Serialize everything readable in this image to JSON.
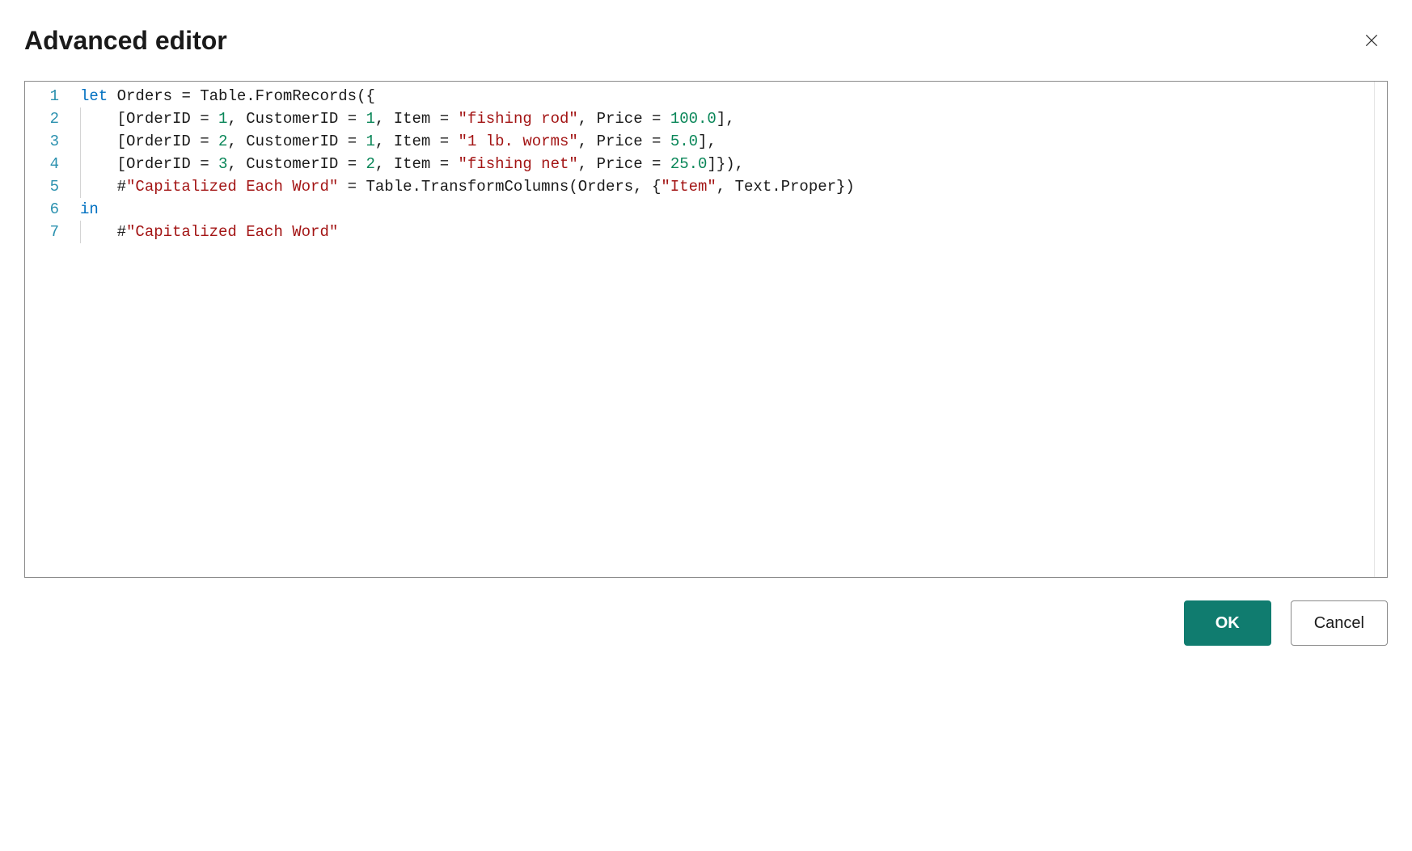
{
  "header": {
    "title": "Advanced editor"
  },
  "editor": {
    "lines": [
      {
        "num": "1",
        "indent": false,
        "tokens": [
          {
            "cls": "kw",
            "t": "let"
          },
          {
            "cls": "ident",
            "t": " Orders "
          },
          {
            "cls": "punct",
            "t": "="
          },
          {
            "cls": "ident",
            "t": " Table.FromRecords"
          },
          {
            "cls": "punct",
            "t": "({"
          }
        ]
      },
      {
        "num": "2",
        "indent": true,
        "tokens": [
          {
            "cls": "punct",
            "t": "    ["
          },
          {
            "cls": "ident",
            "t": "OrderID "
          },
          {
            "cls": "punct",
            "t": "= "
          },
          {
            "cls": "num",
            "t": "1"
          },
          {
            "cls": "punct",
            "t": ", "
          },
          {
            "cls": "ident",
            "t": "CustomerID "
          },
          {
            "cls": "punct",
            "t": "= "
          },
          {
            "cls": "num",
            "t": "1"
          },
          {
            "cls": "punct",
            "t": ", "
          },
          {
            "cls": "ident",
            "t": "Item "
          },
          {
            "cls": "punct",
            "t": "= "
          },
          {
            "cls": "str",
            "t": "\"fishing rod\""
          },
          {
            "cls": "punct",
            "t": ", "
          },
          {
            "cls": "ident",
            "t": "Price "
          },
          {
            "cls": "punct",
            "t": "= "
          },
          {
            "cls": "num",
            "t": "100.0"
          },
          {
            "cls": "punct",
            "t": "],"
          }
        ]
      },
      {
        "num": "3",
        "indent": true,
        "tokens": [
          {
            "cls": "punct",
            "t": "    ["
          },
          {
            "cls": "ident",
            "t": "OrderID "
          },
          {
            "cls": "punct",
            "t": "= "
          },
          {
            "cls": "num",
            "t": "2"
          },
          {
            "cls": "punct",
            "t": ", "
          },
          {
            "cls": "ident",
            "t": "CustomerID "
          },
          {
            "cls": "punct",
            "t": "= "
          },
          {
            "cls": "num",
            "t": "1"
          },
          {
            "cls": "punct",
            "t": ", "
          },
          {
            "cls": "ident",
            "t": "Item "
          },
          {
            "cls": "punct",
            "t": "= "
          },
          {
            "cls": "str",
            "t": "\"1 lb. worms\""
          },
          {
            "cls": "punct",
            "t": ", "
          },
          {
            "cls": "ident",
            "t": "Price "
          },
          {
            "cls": "punct",
            "t": "= "
          },
          {
            "cls": "num",
            "t": "5.0"
          },
          {
            "cls": "punct",
            "t": "],"
          }
        ]
      },
      {
        "num": "4",
        "indent": true,
        "tokens": [
          {
            "cls": "punct",
            "t": "    ["
          },
          {
            "cls": "ident",
            "t": "OrderID "
          },
          {
            "cls": "punct",
            "t": "= "
          },
          {
            "cls": "num",
            "t": "3"
          },
          {
            "cls": "punct",
            "t": ", "
          },
          {
            "cls": "ident",
            "t": "CustomerID "
          },
          {
            "cls": "punct",
            "t": "= "
          },
          {
            "cls": "num",
            "t": "2"
          },
          {
            "cls": "punct",
            "t": ", "
          },
          {
            "cls": "ident",
            "t": "Item "
          },
          {
            "cls": "punct",
            "t": "= "
          },
          {
            "cls": "str",
            "t": "\"fishing net\""
          },
          {
            "cls": "punct",
            "t": ", "
          },
          {
            "cls": "ident",
            "t": "Price "
          },
          {
            "cls": "punct",
            "t": "= "
          },
          {
            "cls": "num",
            "t": "25.0"
          },
          {
            "cls": "punct",
            "t": "]}),"
          }
        ]
      },
      {
        "num": "5",
        "indent": true,
        "tokens": [
          {
            "cls": "ident",
            "t": "    #"
          },
          {
            "cls": "str",
            "t": "\"Capitalized Each Word\""
          },
          {
            "cls": "ident",
            "t": " "
          },
          {
            "cls": "punct",
            "t": "= "
          },
          {
            "cls": "ident",
            "t": "Table.TransformColumns"
          },
          {
            "cls": "punct",
            "t": "("
          },
          {
            "cls": "ident",
            "t": "Orders"
          },
          {
            "cls": "punct",
            "t": ", {"
          },
          {
            "cls": "str",
            "t": "\"Item\""
          },
          {
            "cls": "punct",
            "t": ", "
          },
          {
            "cls": "ident",
            "t": "Text.Proper"
          },
          {
            "cls": "punct",
            "t": "})"
          }
        ]
      },
      {
        "num": "6",
        "indent": false,
        "tokens": [
          {
            "cls": "kw",
            "t": "in"
          }
        ]
      },
      {
        "num": "7",
        "indent": true,
        "tokens": [
          {
            "cls": "ident",
            "t": "    #"
          },
          {
            "cls": "str",
            "t": "\"Capitalized Each Word\""
          }
        ]
      }
    ]
  },
  "footer": {
    "ok_label": "OK",
    "cancel_label": "Cancel"
  }
}
